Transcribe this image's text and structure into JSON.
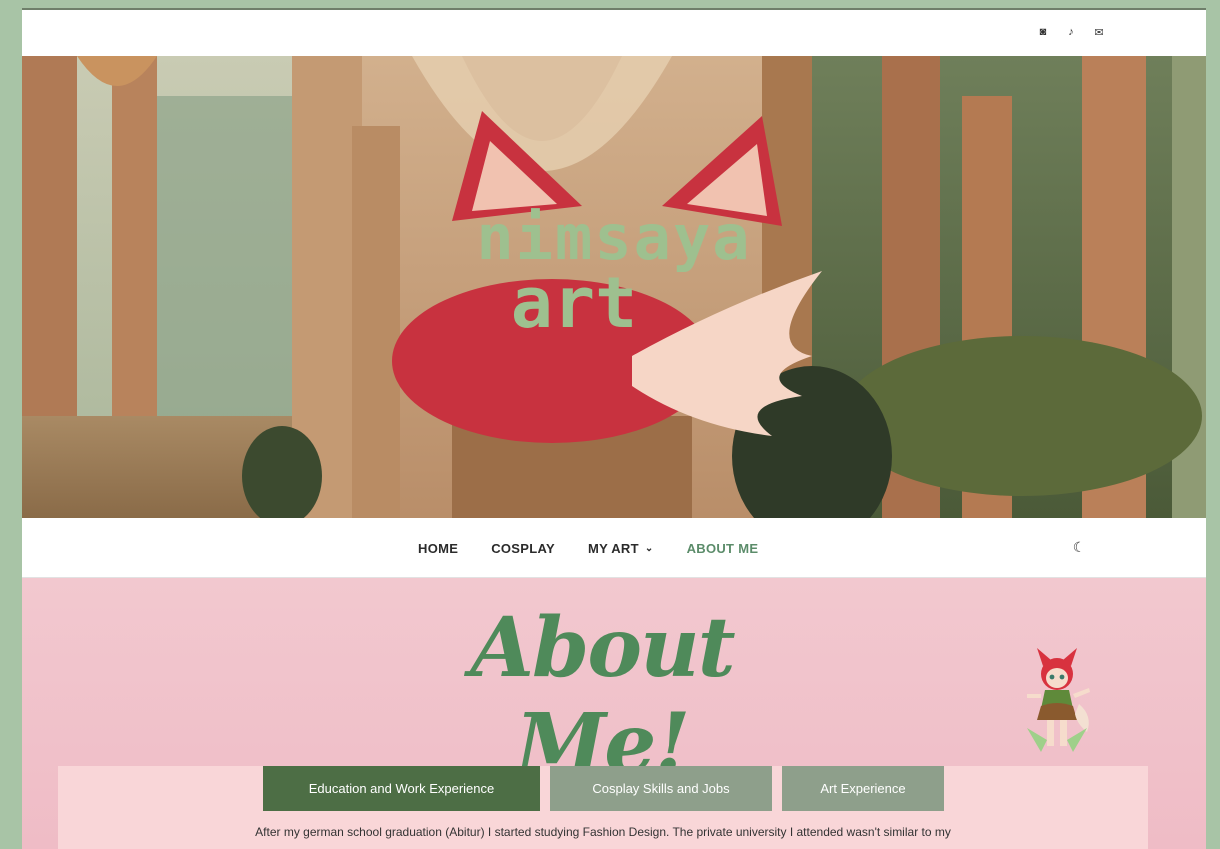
{
  "social": [
    {
      "name": "instagram-icon",
      "glyph": "◙"
    },
    {
      "name": "tiktok-icon",
      "glyph": "♪"
    },
    {
      "name": "mail-icon",
      "glyph": "✉"
    }
  ],
  "logo": {
    "line1": "nimsaya",
    "line2": "art"
  },
  "nav": {
    "items": [
      {
        "label": "HOME"
      },
      {
        "label": "COSPLAY"
      },
      {
        "label": "MY ART",
        "chevron": "⌄"
      },
      {
        "label": "ABOUT ME"
      }
    ],
    "theme_icon": "☾"
  },
  "content": {
    "title": "About Me!",
    "tabs": [
      {
        "label": "Education and Work Experience"
      },
      {
        "label": "Cosplay Skills and Jobs"
      },
      {
        "label": "Art Experience"
      }
    ],
    "text": "After my german school graduation (Abitur) I started studying Fashion Design. The private university I attended wasn't similar to my"
  },
  "colors": {
    "accent_green": "#4f8a5a",
    "active_tab": "#4d6e45",
    "inactive_tab": "#8e9f8b",
    "content_bg": "#f2c8cf",
    "frame_bg": "#a8c4a6",
    "logo_red": "#c8323f"
  }
}
